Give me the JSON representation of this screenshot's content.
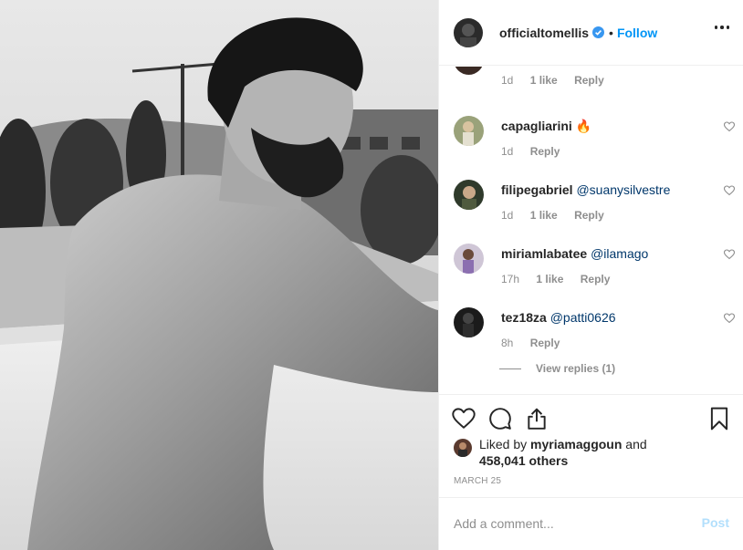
{
  "post": {
    "author": "officialtomellis",
    "verified": true,
    "separator": "•",
    "follow_label": "Follow",
    "more_icon": "more-horizontal-icon",
    "photo": "black-and-white photo of a shirtless bearded man leaning on a balcony railing"
  },
  "comments": [
    {
      "username": "",
      "text": "",
      "time": "1d",
      "likes": "1 like",
      "reply": "Reply"
    },
    {
      "username": "capagliarini",
      "text": "🔥",
      "time": "1d",
      "likes": "",
      "reply": "Reply"
    },
    {
      "username": "filipegabriel",
      "text": "@suanysilvestre",
      "time": "1d",
      "likes": "1 like",
      "reply": "Reply"
    },
    {
      "username": "miriamlabatee",
      "text": "@ilamago",
      "time": "17h",
      "likes": "1 like",
      "reply": "Reply"
    },
    {
      "username": "tez18za",
      "text": "@patti0626",
      "time": "8h",
      "likes": "",
      "reply": "Reply"
    }
  ],
  "view_replies": "View replies (1)",
  "actions": {
    "like_icon": "heart-icon",
    "comment_icon": "comment-icon",
    "share_icon": "share-icon",
    "save_icon": "bookmark-icon"
  },
  "likes": {
    "prefix": "Liked by",
    "user": "myriamaggoun",
    "and": "and",
    "count": "458,041 others"
  },
  "date": "MARCH 25",
  "add_comment": {
    "placeholder": "Add a comment...",
    "post_label": "Post"
  },
  "colors": {
    "accent": "#0095f6",
    "post_disabled": "#b2dffc",
    "mention": "#00376b",
    "meta": "#8e8e8e"
  }
}
